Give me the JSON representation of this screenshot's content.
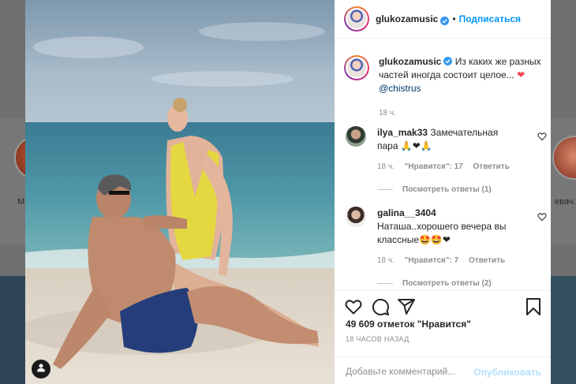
{
  "background": {
    "story_left_label": "М",
    "story_right_label": "евач."
  },
  "post": {
    "username": "glukozamusic",
    "follow_label": "Подписаться",
    "separator": "•",
    "caption_text": "Из каких же разных частей иногда состоит целое...",
    "caption_heart": "❤",
    "caption_mention": "@chistrus",
    "caption_time": "18 ч."
  },
  "comments": [
    {
      "username": "ilya_mak33",
      "text": "Замечательная пара 🙏❤🙏",
      "time": "18 ч.",
      "likes": "\"Нравится\": 17",
      "reply": "Ответить",
      "view_replies": "Посмотреть ответы (1)"
    },
    {
      "username": "galina__3404",
      "text": "Наташа..хорошего вечера вы классные🤩🤩❤",
      "time": "18 ч.",
      "likes": "\"Нравится\": 7",
      "reply": "Ответить",
      "view_replies": "Посмотреть ответы (2)"
    }
  ],
  "footer": {
    "likes_count": "49 609 отметок \"Нравится\"",
    "post_time": "18 ЧАСОВ НАЗАД",
    "comment_placeholder": "Добавьте комментарий...",
    "publish_label": "Опубликовать"
  },
  "colors": {
    "accent": "#0095f6",
    "text": "#262626",
    "muted": "#8e8e8e",
    "heart": "#ed4956"
  },
  "icons": {
    "like": "heart-outline-icon",
    "comment": "speech-bubble-icon",
    "share": "paper-plane-icon",
    "save": "bookmark-icon",
    "tagged": "user-tag-icon"
  }
}
